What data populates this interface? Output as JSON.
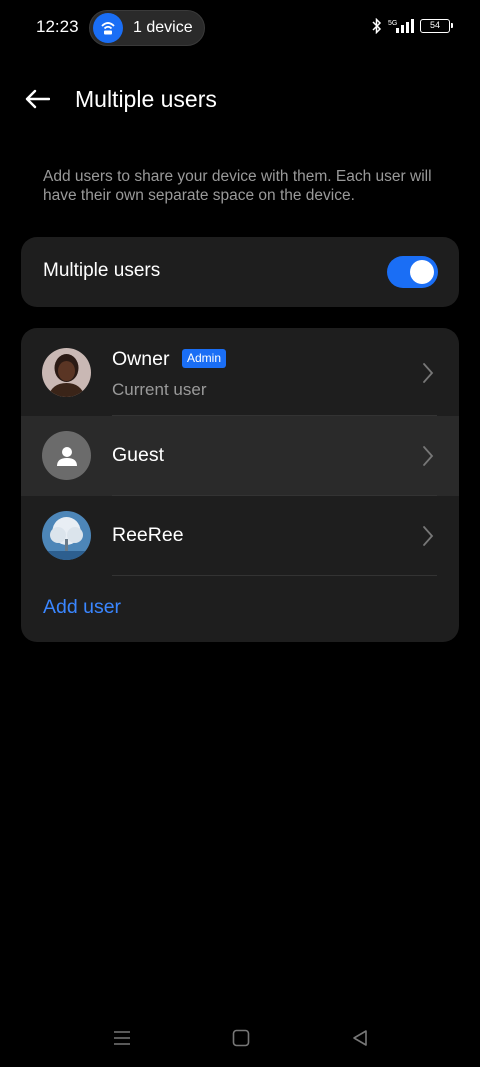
{
  "status_bar": {
    "time": "12:23",
    "hotspot_label": "1 device",
    "network": "5G",
    "battery": "54"
  },
  "header": {
    "title": "Multiple users"
  },
  "description": "Add users to share your device with them. Each user will have their own separate space on the device.",
  "toggle_card": {
    "label": "Multiple users",
    "enabled": true
  },
  "users": [
    {
      "name": "Owner",
      "badge": "Admin",
      "subtitle": "Current user",
      "avatar": "profile-photo"
    },
    {
      "name": "Guest",
      "avatar": "person-icon"
    },
    {
      "name": "ReeRee",
      "avatar": "tree-photo"
    }
  ],
  "add_user_label": "Add user",
  "colors": {
    "accent": "#1a6ef5",
    "link": "#3a86ff",
    "card": "#1e1e1e",
    "background": "#000000"
  }
}
